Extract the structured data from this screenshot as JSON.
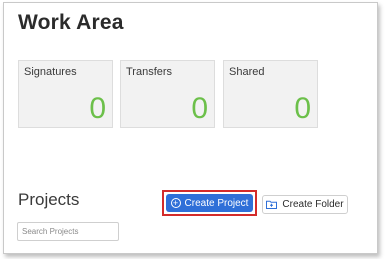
{
  "header": {
    "title": "Work Area"
  },
  "cards": [
    {
      "label": "Signatures",
      "count": "0"
    },
    {
      "label": "Transfers",
      "count": "0"
    },
    {
      "label": "Shared",
      "count": "0"
    }
  ],
  "projects": {
    "heading": "Projects",
    "create_label": "Create Project",
    "folder_label": "Create Folder",
    "search_placeholder": "Search Projects",
    "search_value": ""
  },
  "colors": {
    "accent": "#2f6fd8",
    "count_green": "#6cc04a",
    "highlight": "#d32b2b"
  },
  "icons": {
    "create": "plus-circle-icon",
    "folder": "folder-plus-icon"
  }
}
